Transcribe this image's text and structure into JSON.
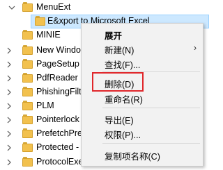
{
  "tree": {
    "items": [
      {
        "label": "MenuExt",
        "chevron": "expanded"
      },
      {
        "label": "E&xport to Microsoft Excel",
        "chevron": "none",
        "selected": true
      },
      {
        "label": "MINIE",
        "chevron": "none"
      },
      {
        "label": "New Windo",
        "chevron": "collapsed"
      },
      {
        "label": "PageSetup",
        "chevron": "collapsed"
      },
      {
        "label": "PdfReader",
        "chevron": "collapsed"
      },
      {
        "label": "PhishingFilt",
        "chevron": "collapsed"
      },
      {
        "label": "PLM",
        "chevron": "collapsed"
      },
      {
        "label": "Pointerlock",
        "chevron": "collapsed"
      },
      {
        "label": "PrefetchPre",
        "chevron": "collapsed"
      },
      {
        "label": "Protected -",
        "chevron": "collapsed"
      },
      {
        "label": "ProtocolExecute",
        "chevron": "collapsed"
      }
    ]
  },
  "context_menu": {
    "items": [
      {
        "label": "展开",
        "bold": true
      },
      {
        "label": "新建(N)",
        "submenu_arrow": "›"
      },
      {
        "label": "查找(F)..."
      },
      {
        "label": "删除(D)",
        "highlighted": true
      },
      {
        "label": "重命名(R)"
      },
      {
        "label": "导出(E)"
      },
      {
        "label": "权限(P)..."
      },
      {
        "label": "复制项名称(C)"
      }
    ]
  },
  "colors": {
    "selection": "#cce8ff",
    "folder": "#f2c14e",
    "highlight_border": "#e0262a",
    "menu_bg": "#f2f2f2"
  }
}
